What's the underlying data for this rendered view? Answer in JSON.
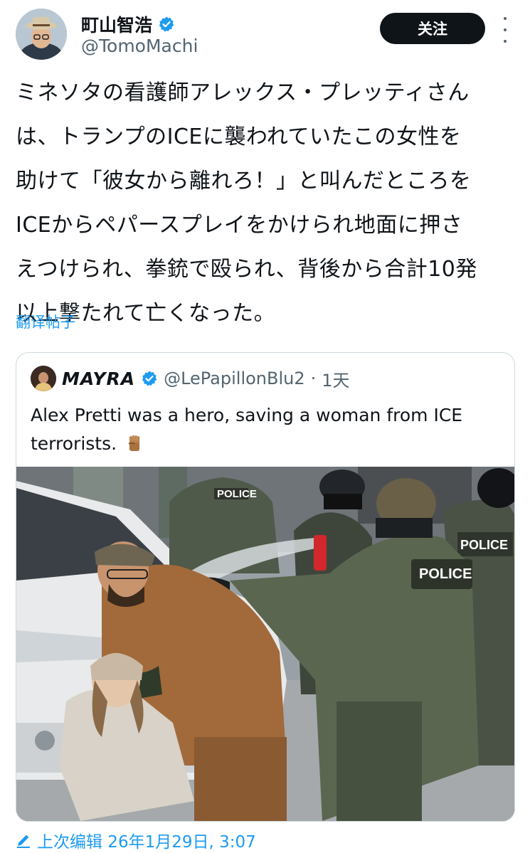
{
  "author": {
    "display_name": "町山智浩",
    "handle": "@TomoMachi",
    "verified": true
  },
  "follow_label": "关注",
  "tweet": {
    "lines": [
      "ミネソタの看護師アレックス・プレッティさん",
      "は、トランプのICEに襲われていたこの女性を",
      "助けて「彼女から離れろ！」と叫んだところを",
      "ICEからペパースプレイをかけられ地面に押さ",
      "えつけられ、拳銃で殴られ、背後から合計10発",
      "以上撃たれて亡くなった。"
    ]
  },
  "translate_label": "翻译帖子",
  "quote": {
    "display_name": "MAYRA",
    "handle": "@LePapillonBlu2",
    "separator": "·",
    "time": "1天",
    "lines": [
      "Alex Pretti was a hero, saving a woman from ICE",
      "terrorists."
    ],
    "emoji": "raised-fist"
  },
  "photo_labels": [
    "POLICE",
    "POLICE",
    "POLICE"
  ],
  "edited": {
    "label": "上次编辑 26年1月29日, 3:07"
  },
  "colors": {
    "accent": "#1d9bf0",
    "text": "#0f1419",
    "secondary": "#536471",
    "border": "#cfd9de",
    "button": "#0f1419"
  }
}
